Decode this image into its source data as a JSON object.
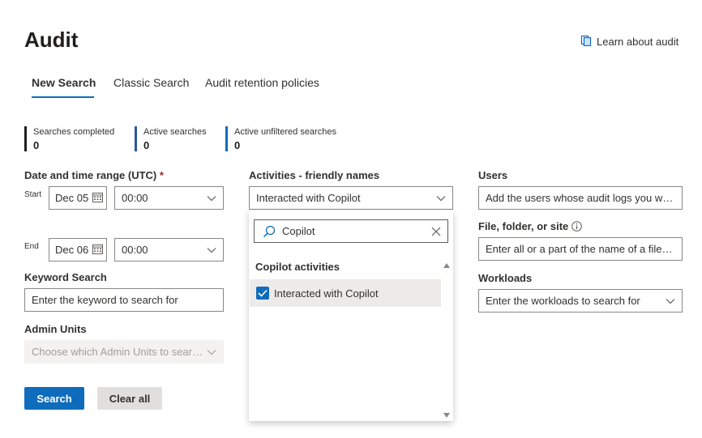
{
  "page": {
    "title": "Audit",
    "learn_link": "Learn about audit"
  },
  "tabs": [
    {
      "label": "New Search"
    },
    {
      "label": "Classic Search"
    },
    {
      "label": "Audit retention policies"
    }
  ],
  "stats": [
    {
      "label": "Searches completed",
      "value": "0",
      "color": "#201f1e"
    },
    {
      "label": "Active searches",
      "value": "0",
      "color": "#2b579a"
    },
    {
      "label": "Active unfiltered searches",
      "value": "0",
      "color": "#0f6cbd"
    }
  ],
  "date_range": {
    "label": "Date and time range (UTC)",
    "required_mark": "*",
    "start_label": "Start",
    "start_date": "Dec 05",
    "start_time": "00:00",
    "end_label": "End",
    "end_date": "Dec 06",
    "end_time": "00:00"
  },
  "keyword": {
    "label": "Keyword Search",
    "placeholder": "Enter the keyword to search for"
  },
  "admin_units": {
    "label": "Admin Units",
    "placeholder": "Choose which Admin Units to search..."
  },
  "activities": {
    "label": "Activities - friendly names",
    "selected": "Interacted with Copilot",
    "search_value": "Copilot",
    "group_header": "Copilot activities",
    "options": [
      {
        "label": "Interacted with Copilot",
        "checked": true
      }
    ]
  },
  "users": {
    "label": "Users",
    "placeholder": "Add the users whose audit logs you want..."
  },
  "file_folder": {
    "label": "File, folder, or site",
    "placeholder": "Enter all or a part of the name of a file, ..."
  },
  "workloads": {
    "label": "Workloads",
    "placeholder": "Enter the workloads to search for"
  },
  "buttons": {
    "search": "Search",
    "clear": "Clear all"
  },
  "colors": {
    "accent": "#0f6cbd",
    "required": "#a4262c"
  },
  "icons": [
    "document-copy-icon",
    "calendar-icon",
    "chevron-down-icon",
    "search-icon",
    "close-icon",
    "checkmark-icon",
    "info-icon",
    "scroll-up-icon",
    "scroll-down-icon"
  ]
}
